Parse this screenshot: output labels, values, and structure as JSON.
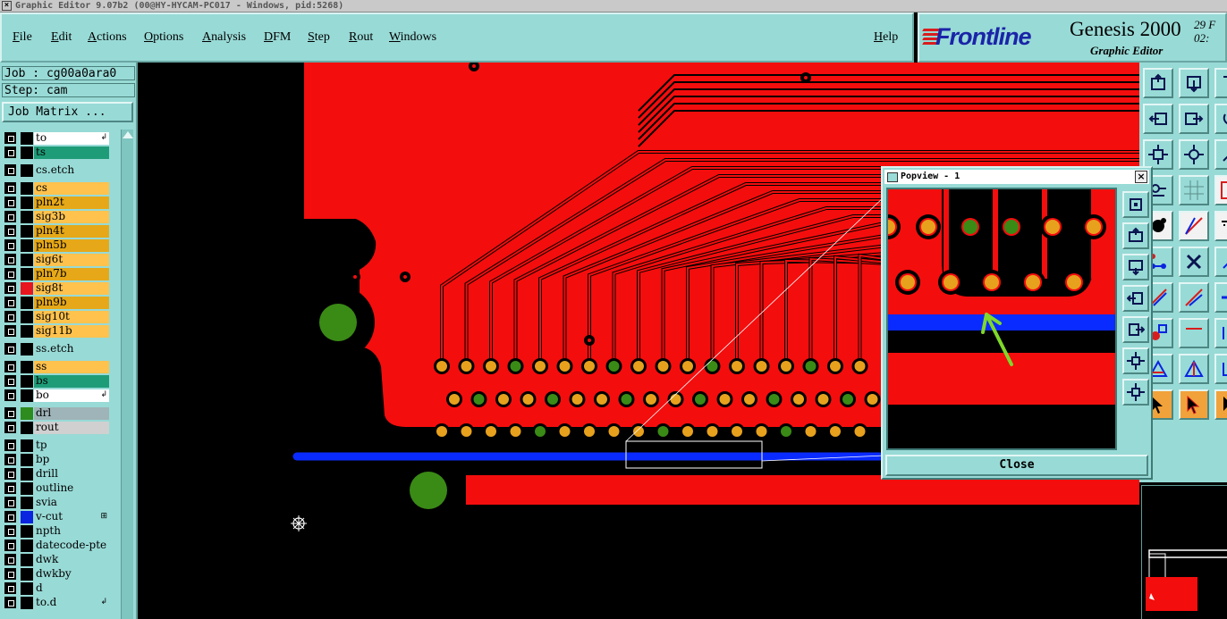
{
  "window": {
    "title": "Graphic Editor 9.07b2 (00@HY-HYCAM-PC017 - Windows, pid:5268)",
    "close_glyph": "×"
  },
  "menubar": {
    "items": [
      "File",
      "Edit",
      "Actions",
      "Options",
      "Analysis",
      "DFM",
      "Step",
      "Rout",
      "Windows"
    ],
    "help": "Help"
  },
  "logo": {
    "brand": "Frontline",
    "product": "Genesis 2000",
    "subtitle": "Graphic Editor",
    "date_line1": "29 F",
    "date_line2": "02:"
  },
  "job": {
    "job_text": "Job : cg00a0ara0",
    "step_text": "Step: cam",
    "job_matrix_label": "Job Matrix ..."
  },
  "layers": [
    {
      "name": "to",
      "color": "#ffffff",
      "flag": "↲",
      "sw": "#000000"
    },
    {
      "name": "ts",
      "color": "#1e9c78",
      "flag": "",
      "sw": "#000000"
    },
    {
      "name": "cs.etch",
      "color": "#98dad6",
      "flag": "",
      "sw": "#000000"
    },
    {
      "name": "cs",
      "color": "#ffc24d",
      "flag": "",
      "sw": "#000000"
    },
    {
      "name": "pln2t",
      "color": "#e6a818",
      "flag": "",
      "sw": "#000000"
    },
    {
      "name": "sig3b",
      "color": "#ffc24d",
      "flag": "",
      "sw": "#000000"
    },
    {
      "name": "pln4t",
      "color": "#e6a818",
      "flag": "",
      "sw": "#000000"
    },
    {
      "name": "pln5b",
      "color": "#e6a818",
      "flag": "",
      "sw": "#000000"
    },
    {
      "name": "sig6t",
      "color": "#ffc24d",
      "flag": "",
      "sw": "#000000"
    },
    {
      "name": "pln7b",
      "color": "#e6a818",
      "flag": "",
      "sw": "#000000"
    },
    {
      "name": "sig8t",
      "color": "#ffc24d",
      "flag": "",
      "sw": "#e8141e"
    },
    {
      "name": "pln9b",
      "color": "#e6a818",
      "flag": "",
      "sw": "#000000"
    },
    {
      "name": "sig10t",
      "color": "#ffc24d",
      "flag": "",
      "sw": "#000000"
    },
    {
      "name": "sig11b",
      "color": "#ffc24d",
      "flag": "",
      "sw": "#000000"
    },
    {
      "name": "ss.etch",
      "color": "#98dad6",
      "flag": "",
      "sw": "#000000"
    },
    {
      "name": "ss",
      "color": "#ffc24d",
      "flag": "",
      "sw": "#000000"
    },
    {
      "name": "bs",
      "color": "#1e9c78",
      "flag": "",
      "sw": "#000000"
    },
    {
      "name": "bo",
      "color": "#ffffff",
      "flag": "↲",
      "sw": "#000000"
    },
    {
      "name": "drl",
      "color": "#9fb4b8",
      "flag": "",
      "sw": "#2e8b1e"
    },
    {
      "name": "rout",
      "color": "#d0d0d0",
      "flag": "",
      "sw": "#000000"
    },
    {
      "name": "tp",
      "color": "#98dad6",
      "flag": "",
      "sw": "#000000"
    },
    {
      "name": "bp",
      "color": "#98dad6",
      "flag": "",
      "sw": "#000000"
    },
    {
      "name": "drill",
      "color": "#98dad6",
      "flag": "",
      "sw": "#000000"
    },
    {
      "name": "outline",
      "color": "#98dad6",
      "flag": "",
      "sw": "#000000"
    },
    {
      "name": "svia",
      "color": "#98dad6",
      "flag": "",
      "sw": "#000000"
    },
    {
      "name": "v-cut",
      "color": "#98dad6",
      "flag": "⊞",
      "sw": "#0a24e0"
    },
    {
      "name": "npth",
      "color": "#98dad6",
      "flag": "",
      "sw": "#000000"
    },
    {
      "name": "datecode-pte",
      "color": "#98dad6",
      "flag": "",
      "sw": "#000000"
    },
    {
      "name": "dwk",
      "color": "#98dad6",
      "flag": "",
      "sw": "#000000"
    },
    {
      "name": "dwkby",
      "color": "#98dad6",
      "flag": "",
      "sw": "#000000"
    },
    {
      "name": "d",
      "color": "#98dad6",
      "flag": "",
      "sw": "#000000"
    },
    {
      "name": "to.d",
      "color": "#98dad6",
      "flag": "↲",
      "sw": "#000000"
    }
  ],
  "colors": {
    "board_red": "#f40d0d",
    "trace_outline": "#000000",
    "pad_orange": "#e7a11d",
    "pad_green": "#3a8a16",
    "vcut_blue": "#0a2bff",
    "panel_teal": "#98dad6",
    "arrow_green": "#7fd82a"
  },
  "popview": {
    "title": "Popview - 1",
    "close_label": "Close",
    "close_glyph": "×"
  },
  "right_toolbar_icons": [
    "zoom-home-icon",
    "zoom-fit-icon",
    "zoom-next-icon",
    "pan-left-icon",
    "pan-right-icon",
    "rotate-icon",
    "zoom-area-icon",
    "center-icon",
    "measure-icon",
    "snap-icon",
    "grid-icon",
    "select-box-icon",
    "pad-icon",
    "line-draw-icon",
    "text-icon",
    "net-icon",
    "cross-icon",
    "polygon-icon",
    "slash-line-icon",
    "slash-line-2-icon",
    "h-line-icon",
    "circle-icon",
    "red-line-icon",
    "anchor-icon",
    "triangle-icon",
    "triangle-2-icon",
    "misc-icon",
    "pointer-icon",
    "pointer-2-icon",
    "pointer-3-icon"
  ],
  "popview_tools": [
    "fit-icon",
    "zoom-in-icon",
    "zoom-out-icon",
    "pan-left-icon",
    "pan-right-icon",
    "expand-icon",
    "contract-icon"
  ]
}
